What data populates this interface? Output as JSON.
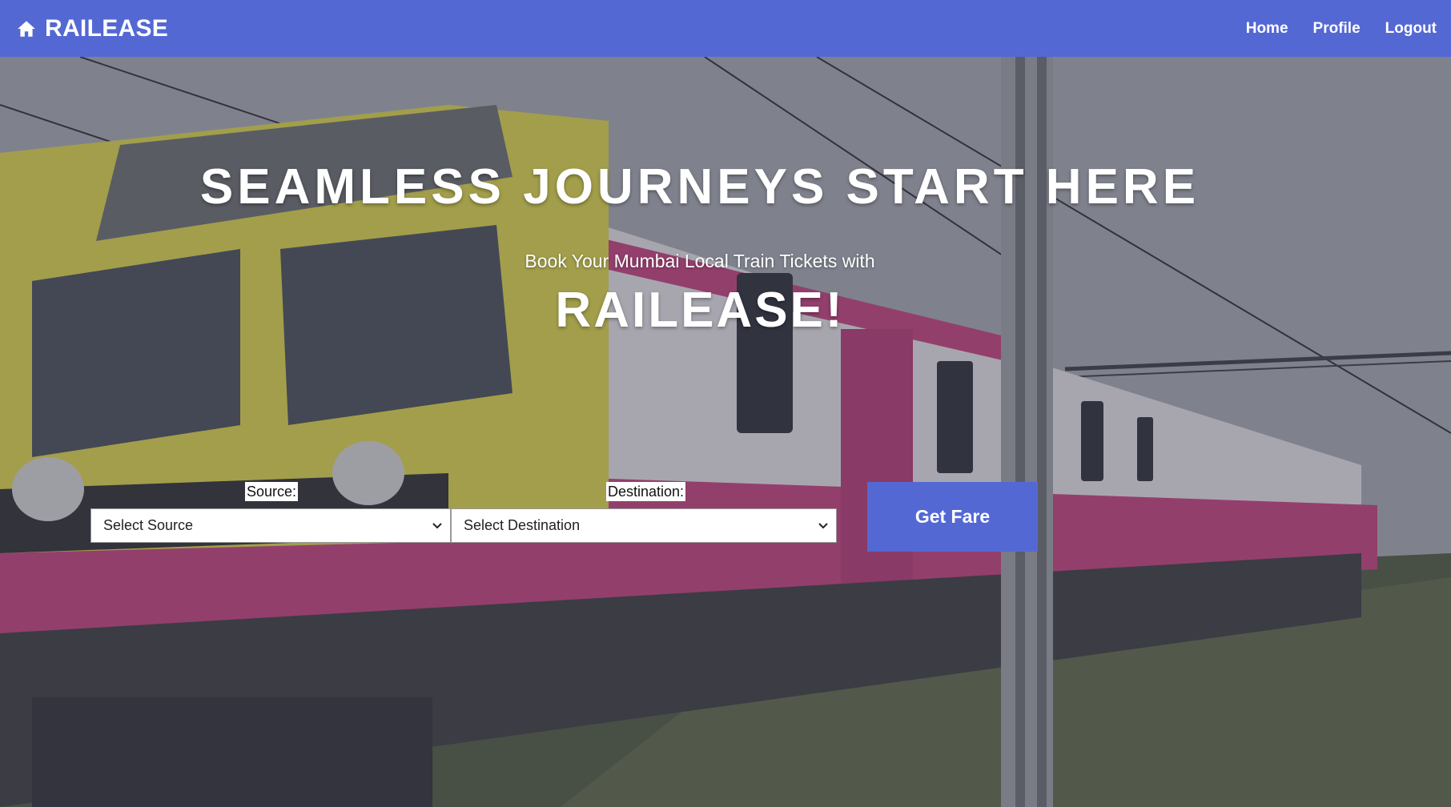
{
  "navbar": {
    "brand": "RAILEASE",
    "brand_icon": "home-icon",
    "links": [
      {
        "label": "Home"
      },
      {
        "label": "Profile"
      },
      {
        "label": "Logout"
      }
    ],
    "color": "#5468d4"
  },
  "hero": {
    "title": "SEAMLESS JOURNEYS START HERE",
    "subtitle": "Book Your Mumbai Local Train Tickets with",
    "brand": "RAILEASE!"
  },
  "form": {
    "source_label": "Source:",
    "source_value": "Select Source",
    "destination_label": "Destination:",
    "destination_value": "Select Destination",
    "button_label": "Get Fare"
  },
  "colors": {
    "accent": "#5468d4"
  }
}
